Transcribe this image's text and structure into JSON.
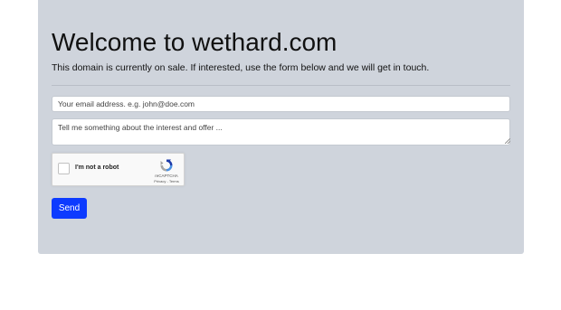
{
  "page": {
    "title": "Welcome to wethard.com",
    "subtitle": "This domain is currently on sale. If interested, use the form below and we will get in touch."
  },
  "form": {
    "email_placeholder": "Your email address. e.g. john@doe.com",
    "message_placeholder": "Tell me something about the interest and offer ...",
    "send_label": "Send"
  },
  "captcha": {
    "label": "I'm not a robot",
    "brand": "reCAPTCHA",
    "privacy": "Privacy",
    "separator": " - ",
    "terms": "Terms",
    "icon": "recaptcha-logo-icon"
  },
  "colors": {
    "card_background": "#cfd4dc",
    "button_background": "#0d3bff",
    "button_text": "#ffffff"
  }
}
